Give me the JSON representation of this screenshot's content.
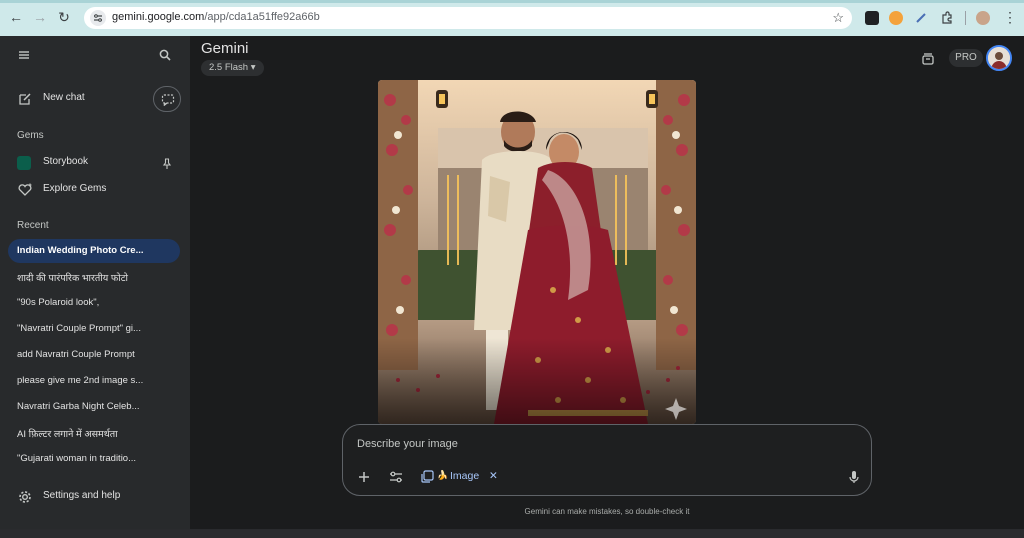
{
  "browser": {
    "url_host": "gemini.google.com",
    "url_path": "/app/cda1a51ffe92a66b"
  },
  "sidebar": {
    "new_chat": "New chat",
    "gems_heading": "Gems",
    "gems": [
      {
        "label": "Storybook"
      },
      {
        "label": "Explore Gems"
      }
    ],
    "recent_heading": "Recent",
    "recent": [
      {
        "label": "Indian Wedding Photo Cre..."
      },
      {
        "label": "शादी की पारंपरिक भारतीय फोटो"
      },
      {
        "label": "\"90s Polaroid look\","
      },
      {
        "label": "\"Navratri Couple Prompt\" gi..."
      },
      {
        "label": "add Navratri Couple Prompt"
      },
      {
        "label": "please give me 2nd image s..."
      },
      {
        "label": "Navratri Garba Night Celeb..."
      },
      {
        "label": "AI फ़िल्टर लगाने में असमर्थता"
      },
      {
        "label": "\"Gujarati woman in traditio..."
      }
    ],
    "settings": "Settings and help"
  },
  "header": {
    "brand": "Gemini",
    "model": "2.5 Flash",
    "plan_badge": "PRO"
  },
  "prompt": {
    "placeholder": "Describe your image",
    "chip_label": "Image"
  },
  "footer": {
    "disclaimer": "Gemini can make mistakes, so double-check it"
  }
}
